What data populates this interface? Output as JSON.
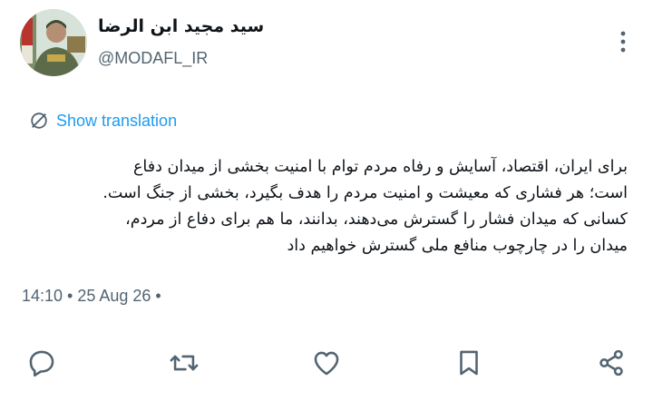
{
  "author": {
    "display_name": "سید مجید ابن الرضا",
    "handle": "@MODAFL_IR"
  },
  "translation": {
    "label": "Show translation"
  },
  "tweet": {
    "lines": [
      "برای ایران، اقتصاد، آسایش و رفاه مردم توام با امنیت بخشی از میدان دفاع",
      "است؛ هر فشاری که معیشت و امنیت مردم را هدف بگیرد، بخشی از جنگ است.",
      "کسانی که میدان فشار را گسترش می‌دهند، بدانند، ما هم برای دفاع از مردم،",
      "میدان را در چارچوب منافع ملی گسترش خواهیم داد"
    ]
  },
  "meta": {
    "time": "14:10 • 25 Aug 26 •"
  },
  "actions": [
    {
      "icon": "reply-icon"
    },
    {
      "icon": "retweet-icon"
    },
    {
      "icon": "like-icon"
    },
    {
      "icon": "bookmark-icon"
    },
    {
      "icon": "share-icon"
    }
  ],
  "colors": {
    "text": "#0f1419",
    "secondary": "#536471",
    "accent": "#1d9bf0"
  }
}
